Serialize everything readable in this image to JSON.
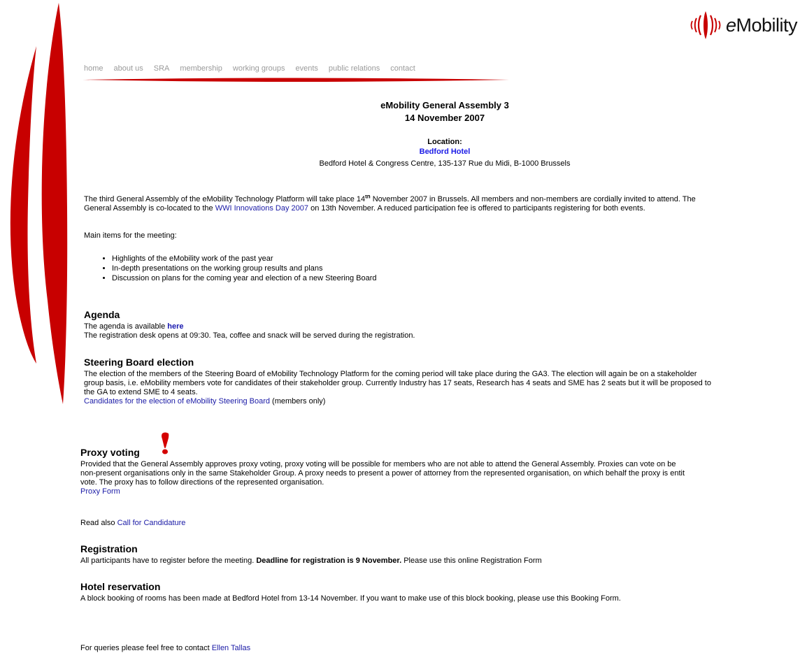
{
  "brand": {
    "logo_text_e": "e",
    "logo_text_rest": "Mobility",
    "accent": "#c80000"
  },
  "nav": [
    "home",
    "about us",
    "SRA",
    "membership",
    "working groups",
    "events",
    "public relations",
    "contact"
  ],
  "heading": {
    "title": "eMobility General Assembly 3",
    "date": "14 November 2007"
  },
  "location": {
    "label": "Location:",
    "hotel": "Bedford Hotel",
    "address": "Bedford Hotel & Congress Centre, 135-137 Rue du Midi, B-1000 Brussels"
  },
  "intro": {
    "p1_a": "The third General Assembly of the eMobility Technology Platform will take place 14",
    "p1_sup": "th",
    "p1_b": " November 2007 in Brussels.  All members and non-members are cordially invited to attend. The",
    "p2_a": "General Assembly is co-located to the ",
    "p2_link": "WWI Innovations Day 2007",
    "p2_b": " on 13th November. A reduced participation fee is offered to participants registering for both events.",
    "items_label": "Main items for the meeting:",
    "items": [
      "Highlights of the eMobility work of the past year",
      "In-depth presentations on the working group results and plans",
      "Discussion on plans for the coming year and election of a new Steering Board"
    ]
  },
  "agenda": {
    "heading": "Agenda",
    "line1_a": "The agenda is available ",
    "line1_link": "here",
    "line2": "The registration desk opens at 09:30. Tea, coffee and snack will be served during the registration."
  },
  "steering": {
    "heading": "Steering Board election",
    "l1": "The election of the members of the Steering Board of eMobility Technology Platform for the coming period will take place during the GA3. The election will again be on a stakeholder",
    "l2": "group basis, i.e. eMobility members vote for candidates of their stakeholder group. Currently Industry has 17 seats, Research has 4 seats and SME has 2 seats but it will be proposed to",
    "l3": "the GA to extend SME to 4 seats.",
    "link": "Candidates for the election of eMobility Steering Board",
    "link_suffix": " (members only)"
  },
  "proxy": {
    "heading": "Proxy voting",
    "l1": "Provided that the General Assembly approves proxy voting, proxy voting will be possible for members who are not able to attend the General Assembly. Proxies can vote on be",
    "l2": "non-present organisations only in the same Stakeholder Group. A proxy needs to present a power of attorney from the represented organisation, on which behalf the proxy is entit",
    "l3": "vote. The proxy has to follow directions of the represented organisation.",
    "form_link": "Proxy Form"
  },
  "read_also": {
    "prefix": "Read also ",
    "link": "Call for Candidature"
  },
  "registration": {
    "heading": "Registration",
    "text_a": "All participants have to register before the meeting. ",
    "text_bold": "Deadline for registration is 9 November.",
    "text_b": "  Please use this online Registration Form"
  },
  "hotel": {
    "heading": "Hotel reservation",
    "text": "A block booking of rooms has been made at Bedford Hotel from 13-14 November. If you want to make use of this block booking, please use this Booking Form."
  },
  "contact": {
    "prefix": "For queries please feel free to contact ",
    "link": "Ellen Tallas"
  }
}
